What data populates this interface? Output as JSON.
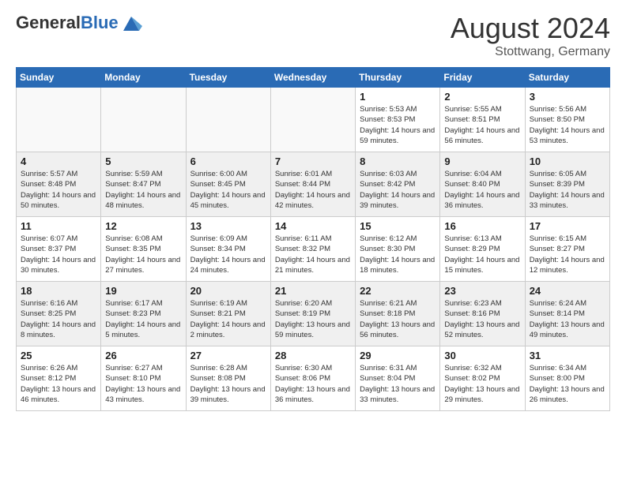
{
  "logo": {
    "general": "General",
    "blue": "Blue"
  },
  "header": {
    "month": "August 2024",
    "location": "Stottwang, Germany"
  },
  "weekdays": [
    "Sunday",
    "Monday",
    "Tuesday",
    "Wednesday",
    "Thursday",
    "Friday",
    "Saturday"
  ],
  "weeks": [
    [
      {
        "day": "",
        "empty": true
      },
      {
        "day": "",
        "empty": true
      },
      {
        "day": "",
        "empty": true
      },
      {
        "day": "",
        "empty": true
      },
      {
        "day": "1",
        "sunrise": "5:53 AM",
        "sunset": "8:53 PM",
        "daylight": "14 hours and 59 minutes."
      },
      {
        "day": "2",
        "sunrise": "5:55 AM",
        "sunset": "8:51 PM",
        "daylight": "14 hours and 56 minutes."
      },
      {
        "day": "3",
        "sunrise": "5:56 AM",
        "sunset": "8:50 PM",
        "daylight": "14 hours and 53 minutes."
      }
    ],
    [
      {
        "day": "4",
        "sunrise": "5:57 AM",
        "sunset": "8:48 PM",
        "daylight": "14 hours and 50 minutes."
      },
      {
        "day": "5",
        "sunrise": "5:59 AM",
        "sunset": "8:47 PM",
        "daylight": "14 hours and 48 minutes."
      },
      {
        "day": "6",
        "sunrise": "6:00 AM",
        "sunset": "8:45 PM",
        "daylight": "14 hours and 45 minutes."
      },
      {
        "day": "7",
        "sunrise": "6:01 AM",
        "sunset": "8:44 PM",
        "daylight": "14 hours and 42 minutes."
      },
      {
        "day": "8",
        "sunrise": "6:03 AM",
        "sunset": "8:42 PM",
        "daylight": "14 hours and 39 minutes."
      },
      {
        "day": "9",
        "sunrise": "6:04 AM",
        "sunset": "8:40 PM",
        "daylight": "14 hours and 36 minutes."
      },
      {
        "day": "10",
        "sunrise": "6:05 AM",
        "sunset": "8:39 PM",
        "daylight": "14 hours and 33 minutes."
      }
    ],
    [
      {
        "day": "11",
        "sunrise": "6:07 AM",
        "sunset": "8:37 PM",
        "daylight": "14 hours and 30 minutes."
      },
      {
        "day": "12",
        "sunrise": "6:08 AM",
        "sunset": "8:35 PM",
        "daylight": "14 hours and 27 minutes."
      },
      {
        "day": "13",
        "sunrise": "6:09 AM",
        "sunset": "8:34 PM",
        "daylight": "14 hours and 24 minutes."
      },
      {
        "day": "14",
        "sunrise": "6:11 AM",
        "sunset": "8:32 PM",
        "daylight": "14 hours and 21 minutes."
      },
      {
        "day": "15",
        "sunrise": "6:12 AM",
        "sunset": "8:30 PM",
        "daylight": "14 hours and 18 minutes."
      },
      {
        "day": "16",
        "sunrise": "6:13 AM",
        "sunset": "8:29 PM",
        "daylight": "14 hours and 15 minutes."
      },
      {
        "day": "17",
        "sunrise": "6:15 AM",
        "sunset": "8:27 PM",
        "daylight": "14 hours and 12 minutes."
      }
    ],
    [
      {
        "day": "18",
        "sunrise": "6:16 AM",
        "sunset": "8:25 PM",
        "daylight": "14 hours and 8 minutes."
      },
      {
        "day": "19",
        "sunrise": "6:17 AM",
        "sunset": "8:23 PM",
        "daylight": "14 hours and 5 minutes."
      },
      {
        "day": "20",
        "sunrise": "6:19 AM",
        "sunset": "8:21 PM",
        "daylight": "14 hours and 2 minutes."
      },
      {
        "day": "21",
        "sunrise": "6:20 AM",
        "sunset": "8:19 PM",
        "daylight": "13 hours and 59 minutes."
      },
      {
        "day": "22",
        "sunrise": "6:21 AM",
        "sunset": "8:18 PM",
        "daylight": "13 hours and 56 minutes."
      },
      {
        "day": "23",
        "sunrise": "6:23 AM",
        "sunset": "8:16 PM",
        "daylight": "13 hours and 52 minutes."
      },
      {
        "day": "24",
        "sunrise": "6:24 AM",
        "sunset": "8:14 PM",
        "daylight": "13 hours and 49 minutes."
      }
    ],
    [
      {
        "day": "25",
        "sunrise": "6:26 AM",
        "sunset": "8:12 PM",
        "daylight": "13 hours and 46 minutes."
      },
      {
        "day": "26",
        "sunrise": "6:27 AM",
        "sunset": "8:10 PM",
        "daylight": "13 hours and 43 minutes."
      },
      {
        "day": "27",
        "sunrise": "6:28 AM",
        "sunset": "8:08 PM",
        "daylight": "13 hours and 39 minutes."
      },
      {
        "day": "28",
        "sunrise": "6:30 AM",
        "sunset": "8:06 PM",
        "daylight": "13 hours and 36 minutes."
      },
      {
        "day": "29",
        "sunrise": "6:31 AM",
        "sunset": "8:04 PM",
        "daylight": "13 hours and 33 minutes."
      },
      {
        "day": "30",
        "sunrise": "6:32 AM",
        "sunset": "8:02 PM",
        "daylight": "13 hours and 29 minutes."
      },
      {
        "day": "31",
        "sunrise": "6:34 AM",
        "sunset": "8:00 PM",
        "daylight": "13 hours and 26 minutes."
      }
    ]
  ]
}
